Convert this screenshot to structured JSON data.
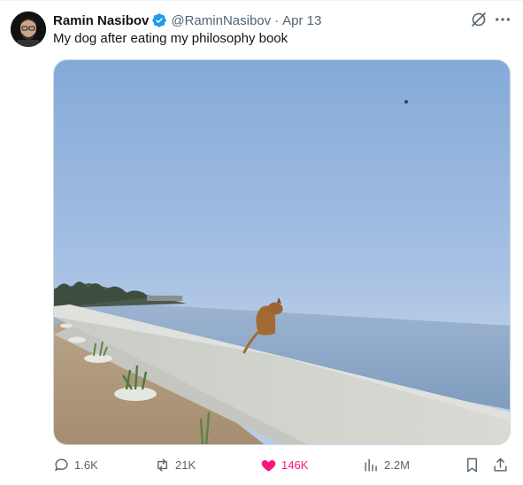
{
  "tweet": {
    "author_name": "Ramin Nasibov",
    "handle": "@RaminNasibov",
    "separator": "·",
    "date": "Apr 13",
    "text": "My dog after eating my philosophy book"
  },
  "actions": {
    "replies": "1.6K",
    "reposts": "21K",
    "likes": "146K",
    "views": "2.2M"
  },
  "colors": {
    "verified": "#1d9bf0",
    "like": "#f91880",
    "muted": "#536471",
    "text": "#0f1419"
  }
}
